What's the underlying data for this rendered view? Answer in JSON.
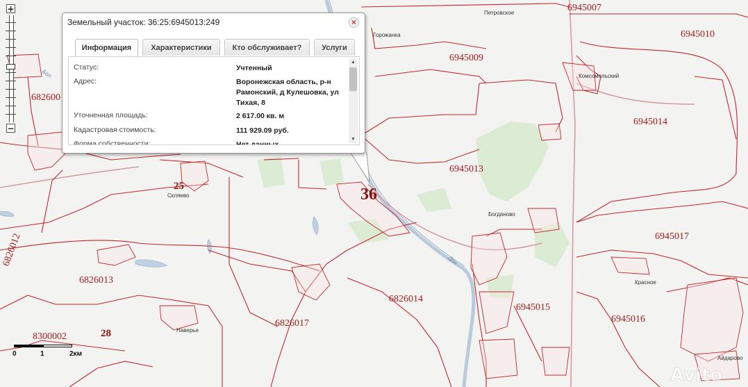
{
  "map": {
    "regions": [
      {
        "id": "6945007",
        "label": "6945007"
      },
      {
        "id": "6945010",
        "label": "6945010"
      },
      {
        "id": "6945009",
        "label": "6945009"
      },
      {
        "id": "6945014",
        "label": "6945014"
      },
      {
        "id": "6945013",
        "label": "6945013"
      },
      {
        "id": "6945017",
        "label": "6945017"
      },
      {
        "id": "6945015",
        "label": "6945015"
      },
      {
        "id": "6945016",
        "label": "6945016"
      },
      {
        "id": "6826014",
        "label": "6826014"
      },
      {
        "id": "6826013",
        "label": "6826013"
      },
      {
        "id": "6826017",
        "label": "6826017"
      },
      {
        "id": "8300002",
        "label": "8300002"
      },
      {
        "id": "6826012",
        "label": "6826012"
      },
      {
        "id": "682600",
        "label": "682600"
      }
    ],
    "districts": {
      "d25": "25",
      "d28": "28",
      "d36": "36"
    },
    "places": {
      "petrovskoe": "Петровское",
      "gorozhanka": "Горожанка",
      "komsomolsky": "Комсомольский",
      "sklyaevo": "Скляево",
      "bogdanovo": "Богданово",
      "krasnoe": "Красное",
      "naverye": "Наверье",
      "aydarovo": "Айдарово"
    },
    "rivers": {
      "don": "Дон",
      "bol": "Бол."
    }
  },
  "zoom": {
    "plus": "+",
    "minus": "−"
  },
  "scale": {
    "l0": "0",
    "l1": "1",
    "l2": "2км"
  },
  "popup": {
    "title": "Земельный участок: 36:25:6945013:249",
    "close_icon": "close-icon",
    "tabs": [
      {
        "label": "Информация",
        "active": true
      },
      {
        "label": "Характеристики",
        "active": false
      },
      {
        "label": "Кто обслуживает?",
        "active": false
      },
      {
        "label": "Услуги",
        "active": false
      }
    ],
    "rows": [
      {
        "key": "Статус:",
        "value": "Учтенный"
      },
      {
        "key": "Адрес:",
        "value": "Воронежская область, р-н Рамонский, д Кулешовка, ул Тихая, 8"
      },
      {
        "key": "Уточненная площадь:",
        "value": "2 617.00 кв. м"
      },
      {
        "key": "Кадастровая стоимость:",
        "value": "111 929.09 руб."
      },
      {
        "key": "Форма собственности:",
        "value": "Нет данных"
      }
    ]
  },
  "watermark": "Avito",
  "colors": {
    "boundary": "#c0272d",
    "forest": "#d9ead0",
    "water": "#b9cde0",
    "road": "#d9a0a6"
  }
}
